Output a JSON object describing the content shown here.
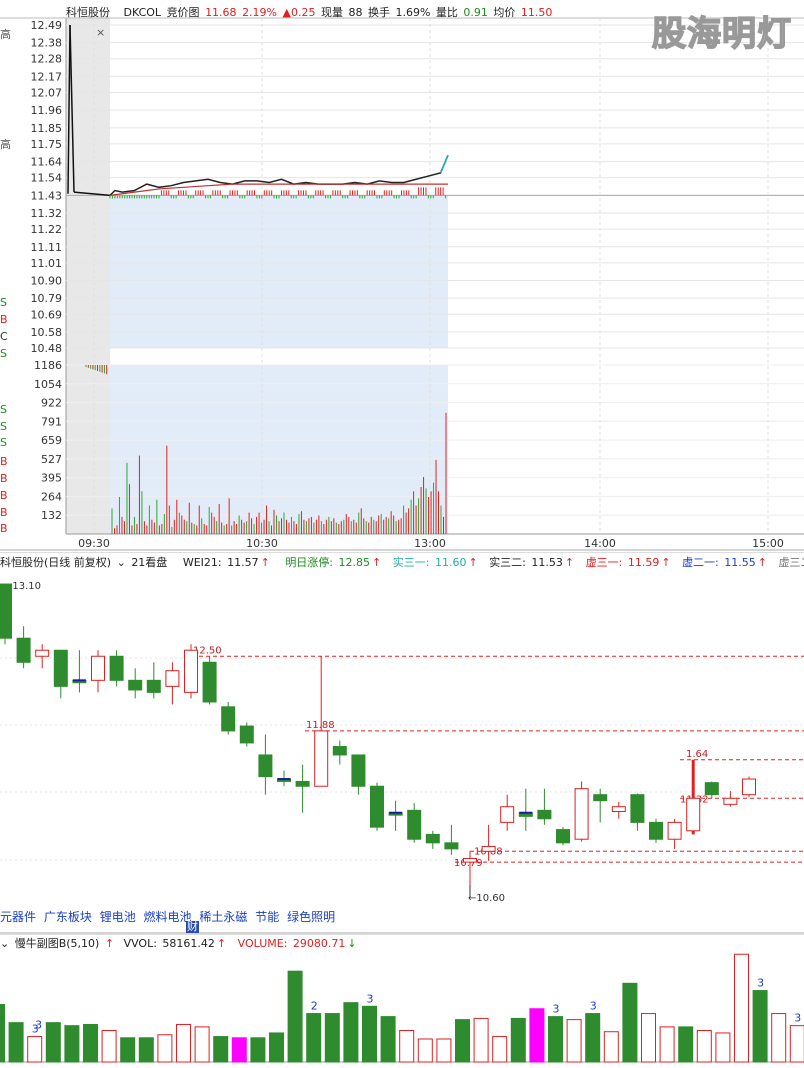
{
  "header_intraday": {
    "name": "科恒股份",
    "indicator": "DKCOL",
    "mode": "竞价图",
    "price": "11.68",
    "pct": "2.19%",
    "change": "▲0.25",
    "now_vol_label": "现量",
    "now_vol": "88",
    "turnover_label": "换手",
    "turnover": "1.69%",
    "vol_ratio_label": "量比",
    "vol_ratio": "0.91",
    "avg_label": "均价",
    "avg": "11.50"
  },
  "watermark": "股海明灯",
  "close_x": "×",
  "intraday_price_ticks": [
    "12.49",
    "12.38",
    "12.28",
    "12.17",
    "12.07",
    "11.96",
    "11.85",
    "11.75",
    "11.64",
    "11.54",
    "11.43",
    "11.32",
    "11.22",
    "11.11",
    "11.01",
    "10.90",
    "10.79",
    "10.69",
    "10.58",
    "10.48"
  ],
  "intraday_vol_ticks": [
    "1186",
    "1054",
    "922",
    "791",
    "659",
    "527",
    "395",
    "264",
    "132"
  ],
  "intraday_time_ticks": [
    "09:30",
    "10:30",
    "13:00",
    "14:00",
    "15:00"
  ],
  "left_edge_letters": [
    "高",
    "高",
    "S",
    "B",
    "C",
    "S",
    "S",
    "S",
    "S",
    "B",
    "B",
    "B",
    "B",
    "B"
  ],
  "header_daily": {
    "title": "科恒股份(日线 前复权)",
    "kan": "21看盘",
    "wei_label": "WEI21:",
    "wei_value": "11.57",
    "mingri_label": "明日涨停:",
    "mingri_value": "12.85",
    "shi31_label": "实三一:",
    "shi31_value": "11.60",
    "shi32_label": "实三二:",
    "shi32_value": "11.53",
    "xu31_label": "虚三一:",
    "xu31_value": "11.59",
    "xu21_label": "虚二一:",
    "xu21_value": "11.55",
    "xu32_label": "虚三二:"
  },
  "daily_annotations": {
    "high_label": "13.10",
    "low_label": "10.60",
    "levels": [
      "12.50",
      "11.88",
      "1.64",
      "11.32",
      "10.88",
      "10.79"
    ]
  },
  "concepts": [
    "元器件",
    "广东板块",
    "锂电池",
    "燃料电池",
    "稀土永磁",
    "节能",
    "绿色照明"
  ],
  "concept_badge": "财",
  "header_volume": {
    "title": "慢牛副图B(5,10)",
    "vvol_label": "VVOL:",
    "vvol_value": "58161.42",
    "volume_label": "VOLUME:",
    "volume_value": "29080.71"
  },
  "colors": {
    "up": "#e02020",
    "down": "#2e8b2e",
    "price_line": "#222222",
    "avg_line": "#c03030",
    "shade": "#e2ecf8",
    "grid": "#c8c8c8",
    "magenta": "#ff00ff",
    "blue_mark": "#1a1aa8"
  },
  "chart_data": [
    {
      "type": "line",
      "title": "科恒股份 DKCOL 竞价图",
      "x_ticks": [
        "09:30",
        "10:30",
        "13:00",
        "14:00",
        "15:00"
      ],
      "ylim": [
        10.48,
        12.49
      ],
      "prev_close": 11.43,
      "series": [
        {
          "name": "price",
          "x": [
            0,
            2,
            5,
            10,
            15,
            20,
            25,
            30,
            35,
            40,
            45,
            50,
            55,
            60,
            65,
            70,
            75,
            80,
            85,
            90,
            95,
            100,
            105,
            110,
            115,
            120,
            125,
            130,
            135,
            138
          ],
          "values": [
            11.43,
            11.46,
            11.45,
            11.46,
            11.5,
            11.48,
            11.49,
            11.51,
            11.52,
            11.53,
            11.51,
            11.5,
            11.52,
            11.52,
            11.51,
            11.53,
            11.5,
            11.51,
            11.5,
            11.5,
            11.5,
            11.51,
            11.5,
            11.52,
            11.51,
            11.51,
            11.53,
            11.55,
            11.57,
            11.68
          ]
        },
        {
          "name": "average",
          "x": [
            0,
            10,
            20,
            30,
            40,
            50,
            60,
            70,
            80,
            90,
            100,
            110,
            120,
            130,
            138
          ],
          "values": [
            11.43,
            11.45,
            11.47,
            11.48,
            11.49,
            11.5,
            11.5,
            11.5,
            11.5,
            11.5,
            11.5,
            11.5,
            11.5,
            11.5,
            11.5
          ]
        }
      ],
      "preopen_spike": [
        12.49,
        11.44
      ]
    },
    {
      "type": "bar",
      "title": "分时成交量",
      "ylim": [
        0,
        1186
      ],
      "values": [
        180,
        40,
        60,
        260,
        120,
        90,
        500,
        350,
        60,
        120,
        70,
        550,
        300,
        90,
        60,
        200,
        100,
        80,
        240,
        60,
        70,
        140,
        620,
        200,
        50,
        100,
        240,
        150,
        130,
        100,
        90,
        220,
        80,
        70,
        60,
        200,
        110,
        70,
        60,
        190,
        150,
        120,
        90,
        210,
        80,
        60,
        70,
        250,
        60,
        90,
        70,
        130,
        100,
        80,
        90,
        150,
        110,
        70,
        120,
        150,
        80,
        100,
        200,
        90,
        60,
        170,
        130,
        90,
        110,
        150,
        100,
        80,
        120,
        90,
        70,
        140,
        160,
        100,
        90,
        110,
        120,
        80,
        100,
        130,
        90,
        70,
        100,
        120,
        90,
        110,
        80,
        70,
        90,
        100,
        140,
        120,
        90,
        100,
        80,
        150,
        180,
        110,
        90,
        80,
        120,
        100,
        90,
        130,
        140,
        100,
        120,
        110,
        160,
        130,
        90,
        100,
        110,
        200,
        150,
        180,
        240,
        300,
        200,
        250,
        330,
        400,
        320,
        260,
        300,
        360,
        520,
        300,
        200,
        120,
        850
      ],
      "directions": "alternating"
    },
    {
      "type": "candlestick",
      "title": "科恒股份(日线 前复权)",
      "ylim": [
        10.5,
        13.2
      ],
      "candles": [
        {
          "o": 13.1,
          "h": 13.1,
          "l": 12.6,
          "c": 12.65,
          "dir": "down"
        },
        {
          "o": 12.65,
          "h": 12.75,
          "l": 12.4,
          "c": 12.45,
          "dir": "down"
        },
        {
          "o": 12.5,
          "h": 12.6,
          "l": 12.4,
          "c": 12.55,
          "dir": "up"
        },
        {
          "o": 12.55,
          "h": 12.55,
          "l": 12.15,
          "c": 12.25,
          "dir": "down"
        },
        {
          "o": 12.3,
          "h": 12.55,
          "l": 12.2,
          "c": 12.28,
          "dir": "down"
        },
        {
          "o": 12.3,
          "h": 12.55,
          "l": 12.2,
          "c": 12.5,
          "dir": "up"
        },
        {
          "o": 12.5,
          "h": 12.55,
          "l": 12.25,
          "c": 12.3,
          "dir": "down"
        },
        {
          "o": 12.3,
          "h": 12.4,
          "l": 12.15,
          "c": 12.22,
          "dir": "down"
        },
        {
          "o": 12.2,
          "h": 12.45,
          "l": 12.15,
          "c": 12.3,
          "dir": "down"
        },
        {
          "o": 12.25,
          "h": 12.45,
          "l": 12.1,
          "c": 12.38,
          "dir": "up"
        },
        {
          "o": 12.2,
          "h": 12.6,
          "l": 12.15,
          "c": 12.55,
          "dir": "up"
        },
        {
          "o": 12.45,
          "h": 12.5,
          "l": 12.1,
          "c": 12.12,
          "dir": "down"
        },
        {
          "o": 12.08,
          "h": 12.12,
          "l": 11.85,
          "c": 11.88,
          "dir": "down"
        },
        {
          "o": 11.92,
          "h": 11.95,
          "l": 11.75,
          "c": 11.78,
          "dir": "down"
        },
        {
          "o": 11.68,
          "h": 11.85,
          "l": 11.35,
          "c": 11.5,
          "dir": "down"
        },
        {
          "o": 11.48,
          "h": 11.55,
          "l": 11.42,
          "c": 11.46,
          "dir": "down"
        },
        {
          "o": 11.46,
          "h": 11.6,
          "l": 11.2,
          "c": 11.42,
          "dir": "down"
        },
        {
          "o": 11.42,
          "h": 12.5,
          "l": 11.42,
          "c": 11.88,
          "dir": "up"
        },
        {
          "o": 11.75,
          "h": 11.8,
          "l": 11.6,
          "c": 11.68,
          "dir": "down"
        },
        {
          "o": 11.68,
          "h": 11.68,
          "l": 11.35,
          "c": 11.42,
          "dir": "down"
        },
        {
          "o": 11.42,
          "h": 11.45,
          "l": 11.05,
          "c": 11.08,
          "dir": "down"
        },
        {
          "o": 11.2,
          "h": 11.3,
          "l": 11.05,
          "c": 11.18,
          "dir": "down"
        },
        {
          "o": 11.22,
          "h": 11.28,
          "l": 10.95,
          "c": 10.98,
          "dir": "down"
        },
        {
          "o": 11.02,
          "h": 11.05,
          "l": 10.9,
          "c": 10.95,
          "dir": "down"
        },
        {
          "o": 10.9,
          "h": 11.1,
          "l": 10.85,
          "c": 10.95,
          "dir": "down"
        },
        {
          "o": 10.79,
          "h": 10.88,
          "l": 10.6,
          "c": 10.82,
          "dir": "up"
        },
        {
          "o": 10.88,
          "h": 11.1,
          "l": 10.8,
          "c": 10.92,
          "dir": "up"
        },
        {
          "o": 11.12,
          "h": 11.35,
          "l": 11.05,
          "c": 11.25,
          "dir": "up"
        },
        {
          "o": 11.2,
          "h": 11.4,
          "l": 11.05,
          "c": 11.17,
          "dir": "down"
        },
        {
          "o": 11.22,
          "h": 11.4,
          "l": 11.1,
          "c": 11.15,
          "dir": "down"
        },
        {
          "o": 11.06,
          "h": 11.08,
          "l": 10.93,
          "c": 10.95,
          "dir": "down"
        },
        {
          "o": 10.98,
          "h": 11.46,
          "l": 10.96,
          "c": 11.4,
          "dir": "up"
        },
        {
          "o": 11.35,
          "h": 11.4,
          "l": 11.12,
          "c": 11.3,
          "dir": "down"
        },
        {
          "o": 11.21,
          "h": 11.29,
          "l": 11.15,
          "c": 11.25,
          "dir": "up"
        },
        {
          "o": 11.35,
          "h": 11.36,
          "l": 11.05,
          "c": 11.12,
          "dir": "down"
        },
        {
          "o": 11.12,
          "h": 11.15,
          "l": 10.95,
          "c": 10.98,
          "dir": "down"
        },
        {
          "o": 10.98,
          "h": 11.15,
          "l": 10.9,
          "c": 11.12,
          "dir": "up"
        },
        {
          "o": 11.05,
          "h": 11.64,
          "l": 11.02,
          "c": 11.32,
          "dir": "up"
        },
        {
          "o": 11.45,
          "h": 11.46,
          "l": 11.32,
          "c": 11.35,
          "dir": "down"
        },
        {
          "o": 11.27,
          "h": 11.38,
          "l": 11.25,
          "c": 11.32,
          "dir": "up"
        },
        {
          "o": 11.35,
          "h": 11.5,
          "l": 11.33,
          "c": 11.48,
          "dir": "up"
        }
      ],
      "levels": [
        12.5,
        11.88,
        11.64,
        11.32,
        10.88,
        10.79
      ],
      "high_mark": 13.1,
      "low_mark": 10.6
    },
    {
      "type": "bar",
      "title": "慢牛副图B(5,10)",
      "values": [
        95,
        65,
        42,
        65,
        60,
        62,
        52,
        40,
        40,
        45,
        62,
        58,
        42,
        40,
        40,
        48,
        150,
        80,
        80,
        98,
        92,
        75,
        52,
        38,
        38,
        70,
        72,
        42,
        72,
        88,
        75,
        70,
        80,
        50,
        130,
        80,
        58,
        58,
        52,
        48,
        178,
        118,
        80,
        60
      ],
      "colors": [
        "down",
        "down",
        "up",
        "down",
        "down",
        "down",
        "up",
        "down",
        "down",
        "up",
        "up",
        "up",
        "down",
        "magenta",
        "down",
        "down",
        "down",
        "down",
        "down",
        "down",
        "down",
        "down",
        "up",
        "up",
        "up",
        "down",
        "up",
        "up",
        "down",
        "magenta",
        "down",
        "up",
        "down",
        "up",
        "down",
        "up",
        "up",
        "down",
        "up",
        "up",
        "up",
        "down",
        "up",
        "up"
      ],
      "labels": {
        "1": "3",
        "2": "3",
        "17": "2",
        "20": "3",
        "30": "3",
        "32": "3",
        "41": "3",
        "43": "3"
      }
    }
  ]
}
